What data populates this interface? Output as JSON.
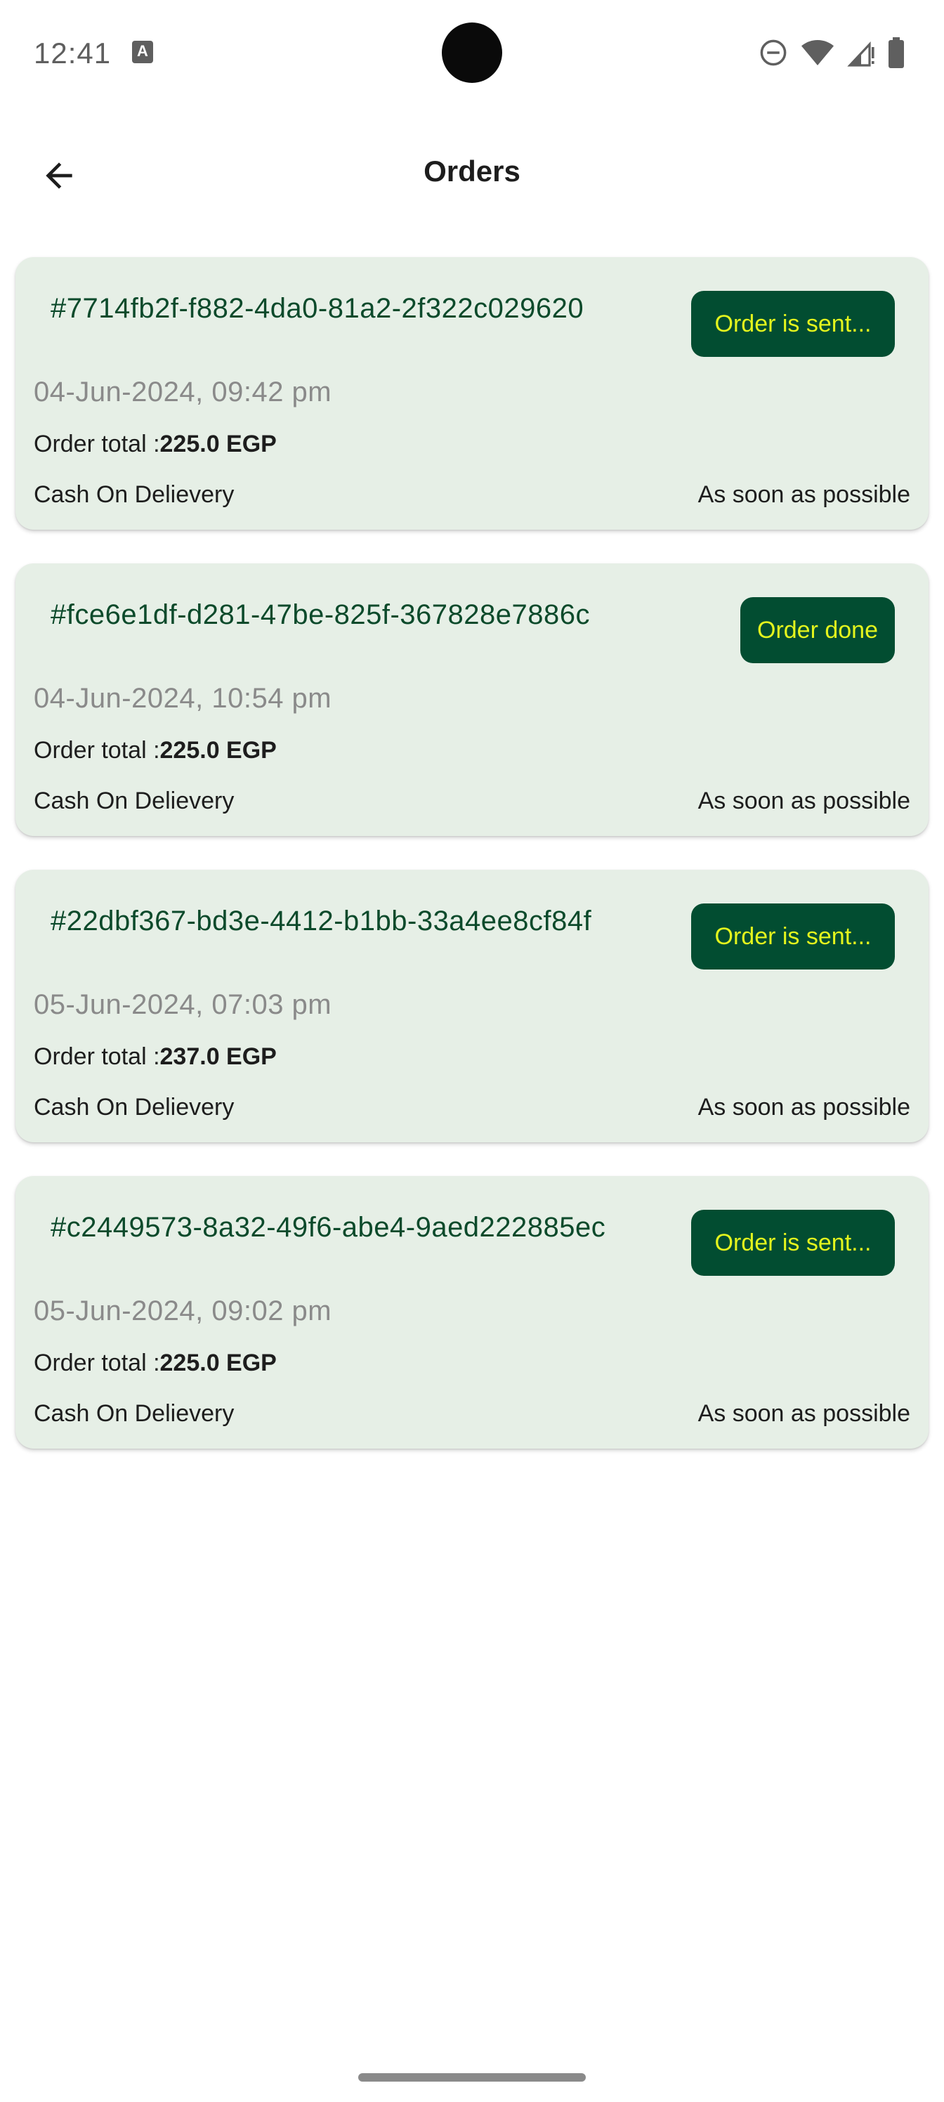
{
  "status_bar": {
    "time": "12:41",
    "app_icon_letter": "A",
    "icons": [
      "do-not-disturb-icon",
      "wifi-icon",
      "signal-icon",
      "battery-icon"
    ]
  },
  "app_bar": {
    "title": "Orders",
    "back_icon": "arrow-back-icon"
  },
  "orders": [
    {
      "id": "#7714fb2f-f882-4da0-81a2-2f322c029620",
      "status": "Order is sent...",
      "date": "04-Jun-2024, 09:42 pm",
      "total_label": "Order total :",
      "total_value": "225.0 EGP",
      "payment": "Cash On Delievery",
      "delivery": "As soon as possible"
    },
    {
      "id": "#fce6e1df-d281-47be-825f-367828e7886c",
      "status": "Order done",
      "date": "04-Jun-2024, 10:54 pm",
      "total_label": "Order total :",
      "total_value": "225.0 EGP",
      "payment": "Cash On Delievery",
      "delivery": "As soon as possible"
    },
    {
      "id": "#22dbf367-bd3e-4412-b1bb-33a4ee8cf84f",
      "status": "Order is sent...",
      "date": "05-Jun-2024, 07:03 pm",
      "total_label": "Order total :",
      "total_value": "237.0 EGP",
      "payment": "Cash On Delievery",
      "delivery": "As soon as possible"
    },
    {
      "id": "#c2449573-8a32-49f6-abe4-9aed222885ec",
      "status": "Order is sent...",
      "date": "05-Jun-2024, 09:02 pm",
      "total_label": "Order total :",
      "total_value": "225.0 EGP",
      "payment": "Cash On Delievery",
      "delivery": "As soon as possible"
    }
  ],
  "colors": {
    "card_background": "#e6efe6",
    "order_id_text": "#0c4a2b",
    "status_pill_background": "#024d31",
    "status_pill_text": "#e4f51d",
    "date_text": "#8a8a8a",
    "primary_text": "#1d1d1d"
  }
}
